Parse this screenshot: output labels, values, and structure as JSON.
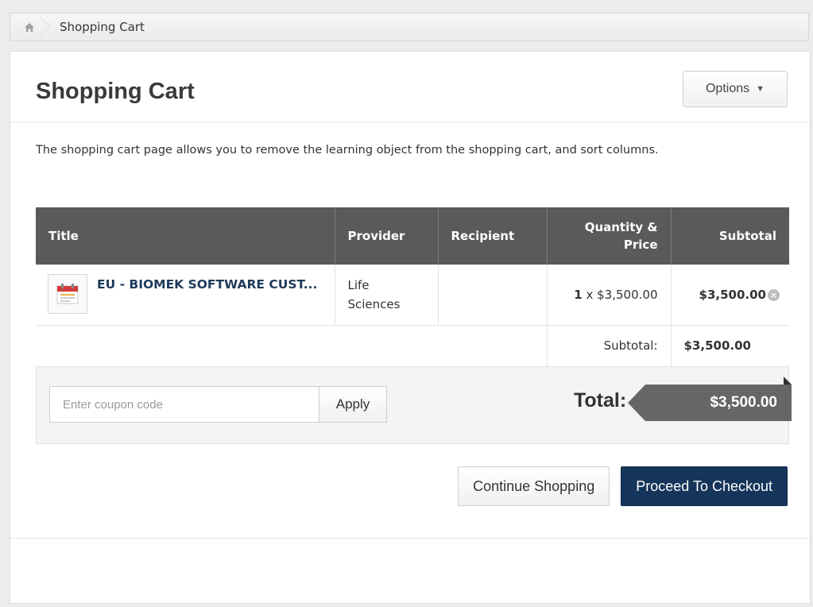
{
  "breadcrumb": {
    "home_icon": "home-icon",
    "current": "Shopping Cart"
  },
  "page": {
    "title": "Shopping Cart",
    "options_label": "Options",
    "description": "The shopping cart page allows you to remove the learning object from the shopping cart, and sort columns."
  },
  "table": {
    "headers": {
      "title": "Title",
      "provider": "Provider",
      "recipient": "Recipient",
      "quantity_price": "Quantity & Price",
      "subtotal": "Subtotal"
    },
    "rows": [
      {
        "title": "EU - BIOMEK SOFTWARE CUST...",
        "provider": "Life Sciences",
        "recipient": "",
        "quantity": "1",
        "price": "x $3,500.00",
        "subtotal": "$3,500.00"
      }
    ],
    "subtotal_label": "Subtotal:",
    "subtotal_value": "$3,500.00"
  },
  "coupon": {
    "placeholder": "Enter coupon code",
    "apply_label": "Apply"
  },
  "total": {
    "label": "Total:",
    "value": "$3,500.00"
  },
  "actions": {
    "continue_label": "Continue Shopping",
    "checkout_label": "Proceed To Checkout"
  },
  "colors": {
    "header_bg": "#5a5a5a",
    "checkout_bg": "#16355a",
    "total_tag": "#666666",
    "link": "#1f3b5c"
  }
}
